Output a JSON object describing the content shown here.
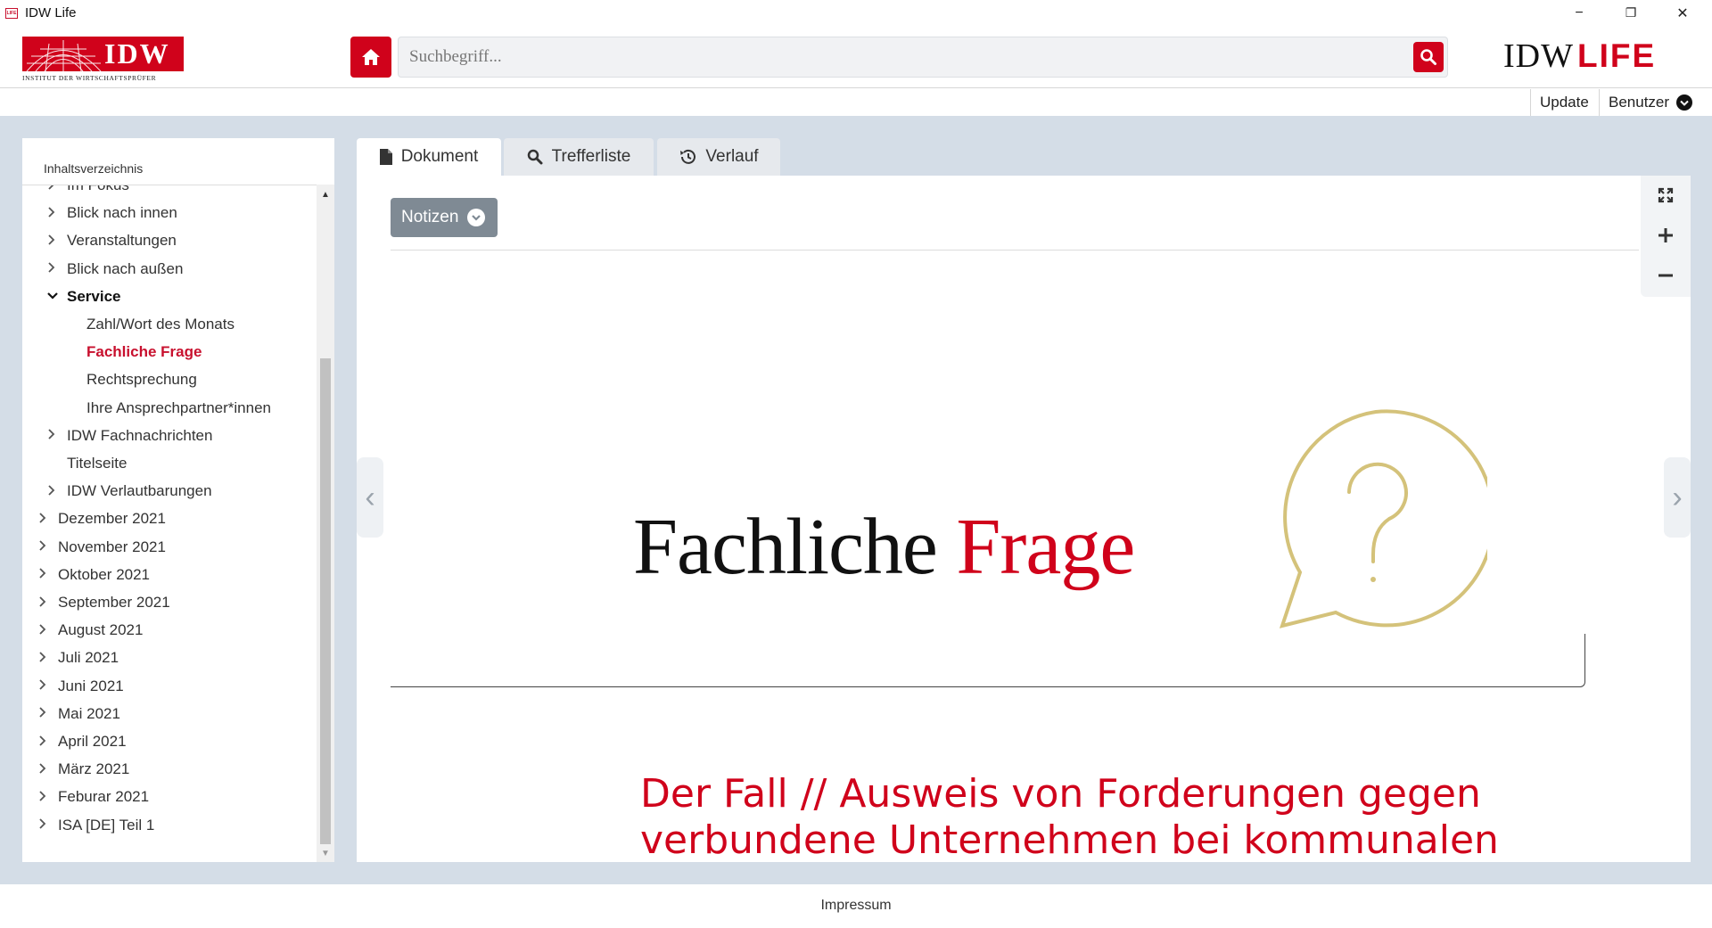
{
  "window": {
    "title": "IDW Life",
    "icon_text": "LIFE",
    "controls": {
      "minimize": "−",
      "restore": "❐",
      "close": "✕"
    }
  },
  "header": {
    "idw_logo": {
      "letters": "IDW",
      "subtitle": "INSTITUT DER WIRTSCHAFTSPRÜFER"
    },
    "search": {
      "placeholder": "Suchbegriff...",
      "value": ""
    },
    "brand": {
      "idw": "IDW",
      "life": "LIFE"
    },
    "accent_color": "#d0021b"
  },
  "toolbar": {
    "update_label": "Update",
    "user_label": "Benutzer"
  },
  "sidebar": {
    "title": "Inhaltsverzeichnis",
    "items": [
      {
        "label": "Im Fokus",
        "level": 1,
        "expandable": true,
        "expanded": false
      },
      {
        "label": "Blick nach innen",
        "level": 1,
        "expandable": true,
        "expanded": false
      },
      {
        "label": "Veranstaltungen",
        "level": 1,
        "expandable": true,
        "expanded": false
      },
      {
        "label": "Blick nach außen",
        "level": 1,
        "expandable": true,
        "expanded": false
      },
      {
        "label": "Service",
        "level": 1,
        "expandable": true,
        "expanded": true
      },
      {
        "label": "Zahl/Wort des Monats",
        "level": 2,
        "expandable": false
      },
      {
        "label": "Fachliche Frage",
        "level": 2,
        "expandable": false,
        "active": true
      },
      {
        "label": "Rechtsprechung",
        "level": 2,
        "expandable": false
      },
      {
        "label": "Ihre Ansprechpartner*innen",
        "level": 2,
        "expandable": false
      },
      {
        "label": "IDW Fachnachrichten",
        "level": 1,
        "expandable": true,
        "expanded": false
      },
      {
        "label": "Titelseite",
        "level": 1,
        "expandable": false
      },
      {
        "label": "IDW Verlautbarungen",
        "level": 1,
        "expandable": true,
        "expanded": false
      },
      {
        "label": "Dezember 2021",
        "level": 0,
        "expandable": true
      },
      {
        "label": "November 2021",
        "level": 0,
        "expandable": true
      },
      {
        "label": "Oktober 2021",
        "level": 0,
        "expandable": true
      },
      {
        "label": "September 2021",
        "level": 0,
        "expandable": true
      },
      {
        "label": "August 2021",
        "level": 0,
        "expandable": true
      },
      {
        "label": "Juli 2021",
        "level": 0,
        "expandable": true
      },
      {
        "label": "Juni 2021",
        "level": 0,
        "expandable": true
      },
      {
        "label": "Mai 2021",
        "level": 0,
        "expandable": true
      },
      {
        "label": "April 2021",
        "level": 0,
        "expandable": true
      },
      {
        "label": "März 2021",
        "level": 0,
        "expandable": true
      },
      {
        "label": "Feburar 2021",
        "level": 0,
        "expandable": true
      },
      {
        "label": "ISA [DE] Teil 1",
        "level": 0,
        "expandable": true
      }
    ]
  },
  "tabs": [
    {
      "label": "Dokument",
      "icon": "document-icon",
      "active": true
    },
    {
      "label": "Trefferliste",
      "icon": "search-icon",
      "active": false
    },
    {
      "label": "Verlauf",
      "icon": "history-icon",
      "active": false
    }
  ],
  "document": {
    "notes_label": "Notizen",
    "section_title_black": "Fachliche ",
    "section_title_red": "Frage",
    "headline": "Der Fall // Ausweis von Forderungen gegen verbundene Unternehmen bei kommunalen",
    "bubble_color": "#d4c27a"
  },
  "footer": {
    "impressum": "Impressum"
  }
}
